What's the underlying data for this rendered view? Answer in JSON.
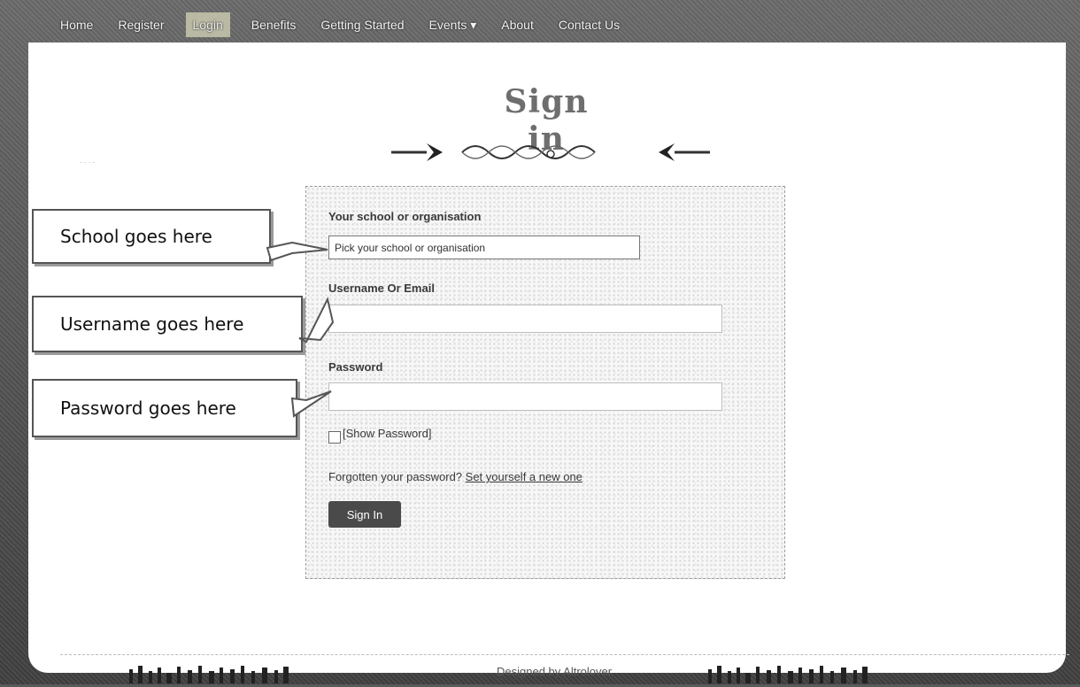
{
  "nav": {
    "items": [
      "Home",
      "Register",
      "Login",
      "Benefits",
      "Getting Started",
      "Events ▾",
      "About",
      "Contact Us"
    ],
    "active_index": 2
  },
  "page": {
    "title": "Sign in"
  },
  "form": {
    "school_label": "Your school or organisation",
    "school_select_value": "Pick your school or organisation",
    "username_label": "Username Or Email",
    "username_value": "",
    "password_label": "Password",
    "password_value": "",
    "show_password_label": "[Show Password]",
    "forgot_text": "Forgotten your password?",
    "forgot_link": "Set yourself a new one",
    "signin_button": "Sign In"
  },
  "callouts": {
    "school": "School goes here",
    "username": "Username goes here",
    "password": "Password goes here"
  },
  "footer": {
    "designed_by": "Designed by Altrolover."
  },
  "colors": {
    "nav_background": "#4a4a4a",
    "active_nav": "#b9b9a4",
    "button": "#4a4a4a"
  }
}
